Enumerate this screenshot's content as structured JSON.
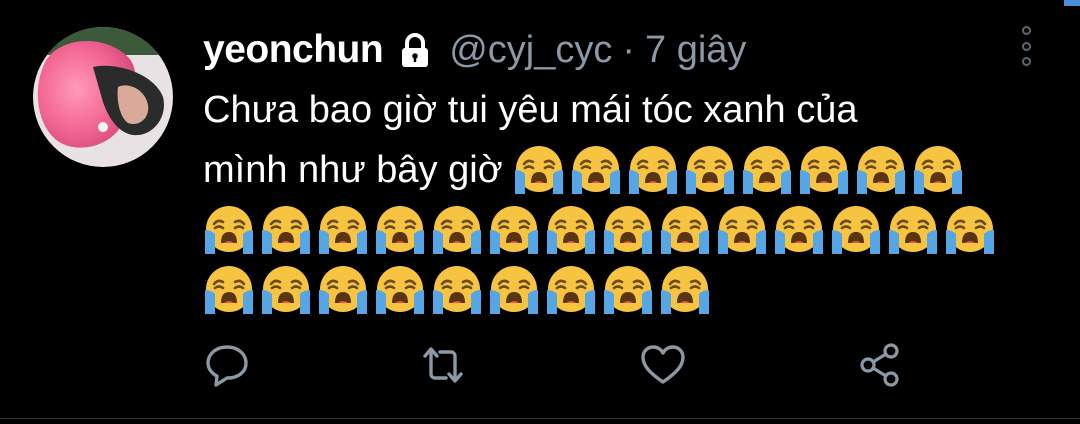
{
  "tweet": {
    "display_name": "yeonchun",
    "handle": "@cyj_cyc",
    "separator": "·",
    "time": "7 giây",
    "text_line1": "Chưa bao giờ tui yêu mái tóc xanh của",
    "text_line2": "mình như bây giờ",
    "emoji": "loudly-crying-face",
    "emoji_counts": {
      "line2": 8,
      "line3": 14,
      "line4": 9
    },
    "locked": true
  },
  "icons": {
    "lock": "lock-icon",
    "more": "more-vertical-icon",
    "reply": "reply-icon",
    "retweet": "retweet-icon",
    "like": "heart-icon",
    "share": "share-icon"
  },
  "colors": {
    "background": "#000000",
    "text": "#ffffff",
    "muted": "#8b98a5",
    "icon": "#8b98a5"
  }
}
